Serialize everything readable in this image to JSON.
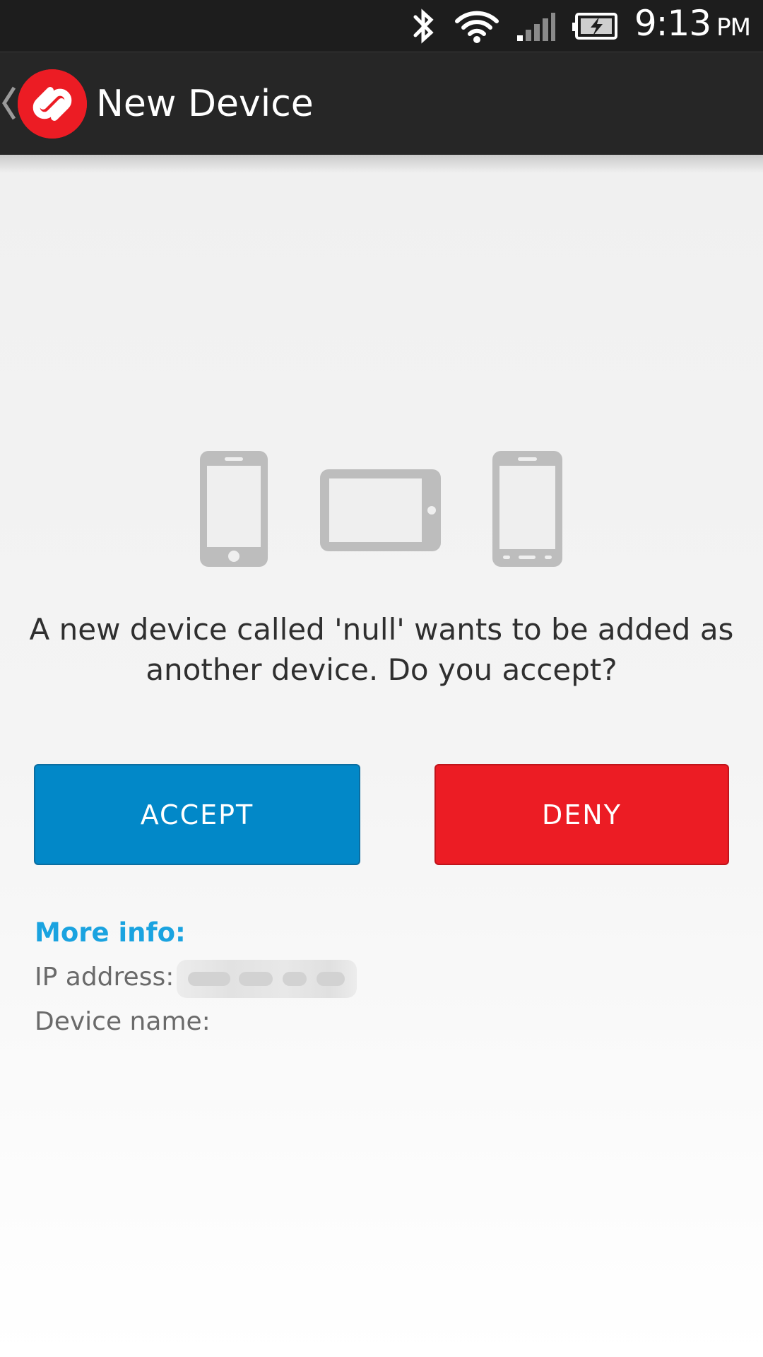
{
  "status_bar": {
    "time": "9:13",
    "ampm": "PM",
    "icons": [
      "bluetooth-icon",
      "wifi-icon",
      "signal-icon",
      "battery-charging-icon"
    ],
    "background_color": "#1d1d1d"
  },
  "action_bar": {
    "title": "New Device",
    "back_icon": "chevron-left-icon",
    "logo_icon": "authy-logo-icon",
    "logo_color": "#ec1c24"
  },
  "illustration": {
    "icons": [
      "phone-icon",
      "tablet-landscape-icon",
      "phone-icon"
    ],
    "color": "#bdbdbd"
  },
  "main": {
    "message": "A new device called 'null' wants to be added as another device. Do you accept?",
    "accept_label": "ACCEPT",
    "deny_label": "DENY",
    "accept_color": "#0288c8",
    "deny_color": "#ec1c24"
  },
  "more_info": {
    "heading": "More info:",
    "ip_label": "IP address:",
    "device_name_label": "Device name:",
    "heading_color": "#1aa3e0"
  }
}
